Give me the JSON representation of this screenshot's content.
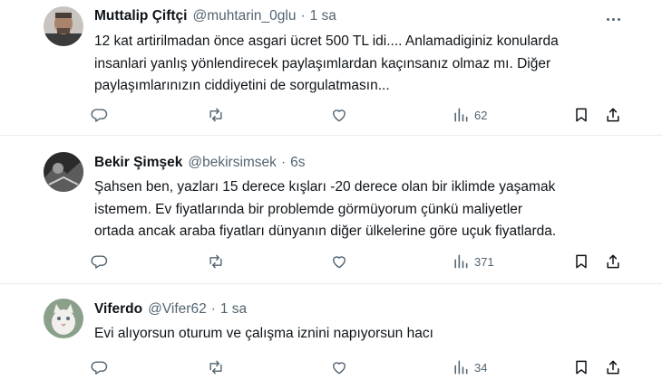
{
  "tweets": [
    {
      "name": "Muttalip Çiftçi",
      "handle": "@muhtarin_0glu",
      "time": "1 sa",
      "lines": [
        "12 kat artirilmadan önce asgari ücret 500 TL idi.... Anlamadiginiz konularda",
        "insanlari yanlış yönlendirecek paylaşımlardan kaçınsanız olmaz mı. Diğer",
        "paylaşımlarınızın ciddiyetini de sorgulatmasın..."
      ],
      "views": "62"
    },
    {
      "name": "Bekir Şimşek",
      "handle": "@bekirsimsek",
      "time": "6s",
      "lines": [
        "Şahsen ben, yazları 15 derece kışları -20 derece olan bir iklimde yaşamak",
        "istemem. Ev fiyatlarında bir problemde görmüyorum çünkü maliyetler",
        "ortada ancak araba fiyatları dünyanın diğer ülkelerine göre uçuk fiyatlarda."
      ],
      "views": "371"
    },
    {
      "name": "Viferdo",
      "handle": "@Vifer62",
      "time": "1 sa",
      "lines": [
        "Evi alıyorsun oturum ve çalışma iznini napıyorsun hacı"
      ],
      "views": "34"
    }
  ],
  "icons": {
    "reply": "reply-icon",
    "retweet": "retweet-icon",
    "like": "like-icon",
    "views": "views-icon",
    "bookmark": "bookmark-icon",
    "share": "share-icon",
    "more": "more-icon"
  },
  "colors": {
    "text": "#0f1419",
    "secondary": "#536471",
    "divider": "#e6ecf0"
  }
}
